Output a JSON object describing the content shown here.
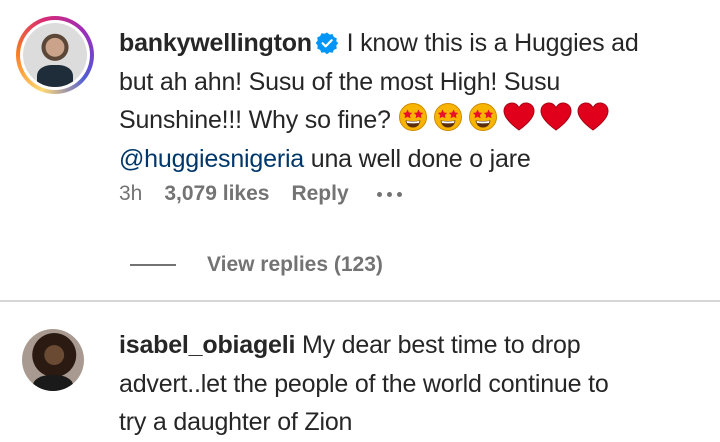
{
  "comments": [
    {
      "username": "bankywellington",
      "verified": true,
      "text_line1": "I know this is a Huggies ad",
      "text_line2": "but ah ahn! Susu of the most High! Susu",
      "text_line3": "Sunshine!!! Why so fine?",
      "emojis": [
        "star-struck-emoji",
        "star-struck-emoji",
        "star-struck-emoji",
        "red-heart-emoji",
        "red-heart-emoji",
        "red-heart-emoji"
      ],
      "mention": "@huggiesnigeria",
      "text_after_mention": " una well done o jare",
      "time": "3h",
      "likes": "3,079 likes",
      "reply_label": "Reply",
      "view_replies": "View replies (123)"
    },
    {
      "username": "isabel_obiageli",
      "text_line1": "My dear best time to drop",
      "text_line2": "advert..let the people of the world continue to",
      "text_line3": "try a daughter of Zion"
    }
  ],
  "colors": {
    "text": "#262626",
    "secondary": "#737373",
    "mention": "#00376b",
    "verified": "#0095f6",
    "heart": "#e0001b",
    "emoji_face": "#f7b500"
  }
}
